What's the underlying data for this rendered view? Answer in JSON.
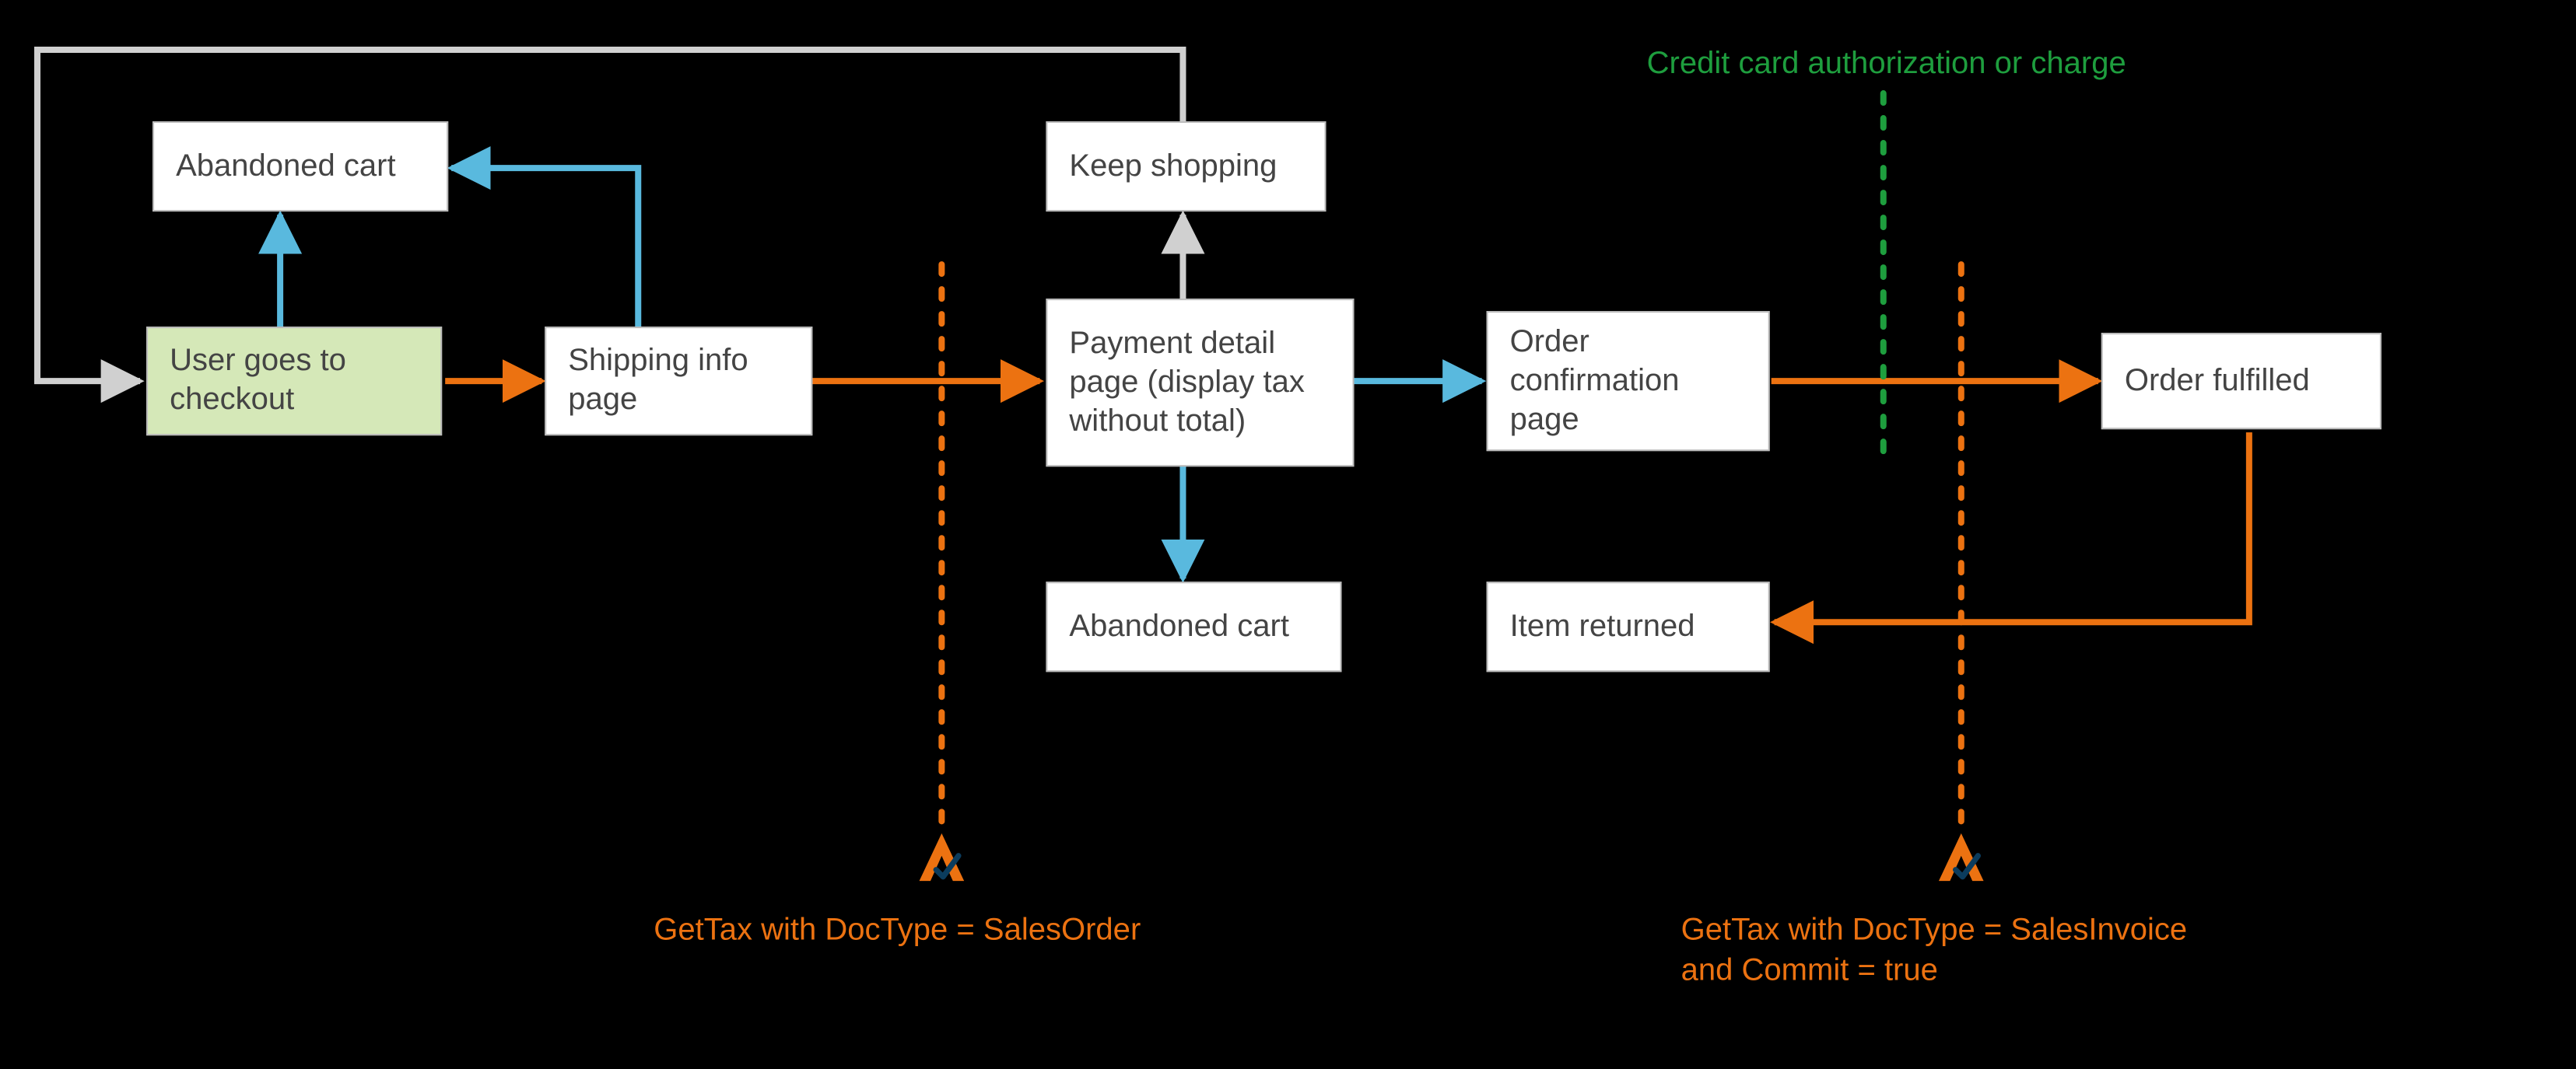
{
  "nodes": {
    "user_checkout": "User goes to checkout",
    "abandoned_cart_1": "Abandoned cart",
    "shipping_info": "Shipping info page",
    "keep_shopping": "Keep shopping",
    "payment_detail": "Payment detail page (display tax without total)",
    "abandoned_cart_2": "Abandoned cart",
    "order_confirmation": "Order confirmation page",
    "item_returned": "Item returned",
    "order_fulfilled": "Order fulfilled"
  },
  "annotations": {
    "credit_card": "Credit card authorization or charge",
    "gettax_order": "GetTax with DocType = SalesOrder",
    "gettax_invoice": "GetTax with DocType = SalesInvoice\nand Commit = true"
  },
  "colors": {
    "orange": "#ec7211",
    "blue": "#59b9de",
    "gray": "#d0d0d0",
    "green": "#1e9e3e",
    "navy": "#0b3c5d"
  }
}
